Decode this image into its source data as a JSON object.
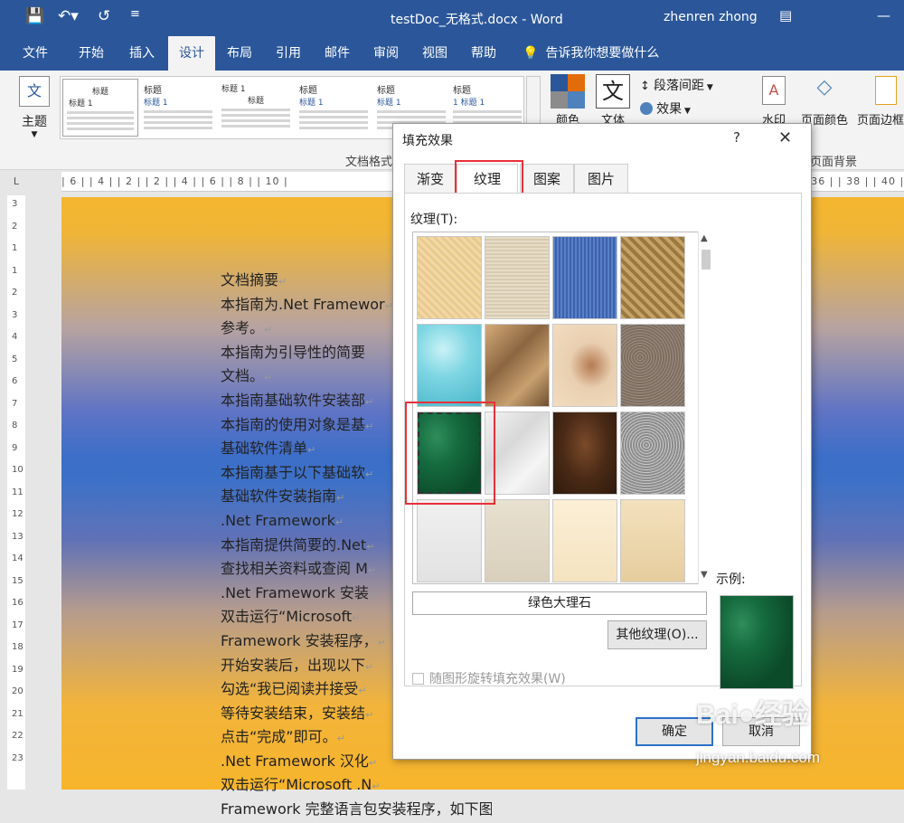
{
  "window": {
    "title": "testDoc_无格式.docx - Word",
    "user": "zhenren zhong",
    "quick_access": {
      "save": "💾",
      "undo": "↶▾",
      "redo": "↺",
      "customize": "≡"
    },
    "controls": {
      "ribbon_options": "▤",
      "minimize": "—"
    }
  },
  "tabs": [
    "文件",
    "开始",
    "插入",
    "设计",
    "布局",
    "引用",
    "邮件",
    "审阅",
    "视图",
    "帮助"
  ],
  "tell_me": "告诉我你想要做什么",
  "ribbon": {
    "theme_label": "主题",
    "colors_label": "颜色",
    "fonts_label": "文体",
    "paragraph_spacing": "段落间距",
    "effects": "效果",
    "watermark": "水印",
    "page_color": "页面颜色",
    "page_border": "页面边框",
    "group_document_format": "文档格式",
    "group_page_background": "页面背景",
    "style_thumbs": [
      {
        "title": "标题",
        "sub": "标题 1"
      },
      {
        "title": "标题",
        "sub": "标题 1"
      },
      {
        "title": "标题",
        "sub": "标题 1"
      },
      {
        "title": "标题",
        "sub": "标题 1"
      },
      {
        "title": "标题",
        "sub": "标题 1"
      },
      {
        "title": "标题",
        "sub": "1 标题 1"
      }
    ]
  },
  "ruler": {
    "h_left": "| 6 |  | 4 |  | 2 |  | 2 |  | 4 |  | 6 |  | 8 |  | 10 |",
    "h_right": "| 36 |  | 38 |  | 40 |",
    "v_numbers": [
      "3",
      "2",
      "1",
      "1",
      "2",
      "3",
      "4",
      "5",
      "6",
      "7",
      "8",
      "9",
      "10",
      "11",
      "12",
      "13",
      "14",
      "15",
      "16",
      "17",
      "18",
      "19",
      "20",
      "21",
      "22",
      "23"
    ]
  },
  "document": {
    "lines": [
      "文档摘要",
      "本指南为.Net Framewor",
      "参考。",
      "本指南为引导性的简要",
      "文档。",
      "本指南基础软件安装部",
      "本指南的使用对象是基",
      "基础软件清单",
      "本指南基于以下基础软",
      "基础软件安装指南",
      ".Net Framework",
      "本指南提供简要的.Net",
      "查找相关资料或查阅 M",
      ".Net Framework 安装",
      "双击运行“Microsoft",
      "Framework 安装程序，",
      "开始安装后，出现以下",
      "勾选“我已阅读并接受",
      "等待安装结束，安装结",
      "点击“完成”即可。",
      ".Net Framework 汉化",
      "双击运行“Microsoft .N",
      "Framework 完整语言包安装程序，如下图："
    ],
    "para_mark": "↵"
  },
  "dialog": {
    "title": "填充效果",
    "help": "?",
    "close": "✕",
    "tabs": [
      "渐变",
      "纹理",
      "图案",
      "图片"
    ],
    "active_tab": "纹理",
    "texture_label": "纹理(T):",
    "selected_texture": "绿色大理石",
    "other_textures": "其他纹理(O)...",
    "example_label": "示例:",
    "rotate_with_shape": "随图形旋转填充效果(W)",
    "ok": "确定",
    "cancel": "取消",
    "colors": {
      "green_marble": "#0d5230",
      "highlight": "#e8303a"
    }
  },
  "watermark": {
    "main": "Bai●经验",
    "sub": "jingyan.baidu.com"
  }
}
